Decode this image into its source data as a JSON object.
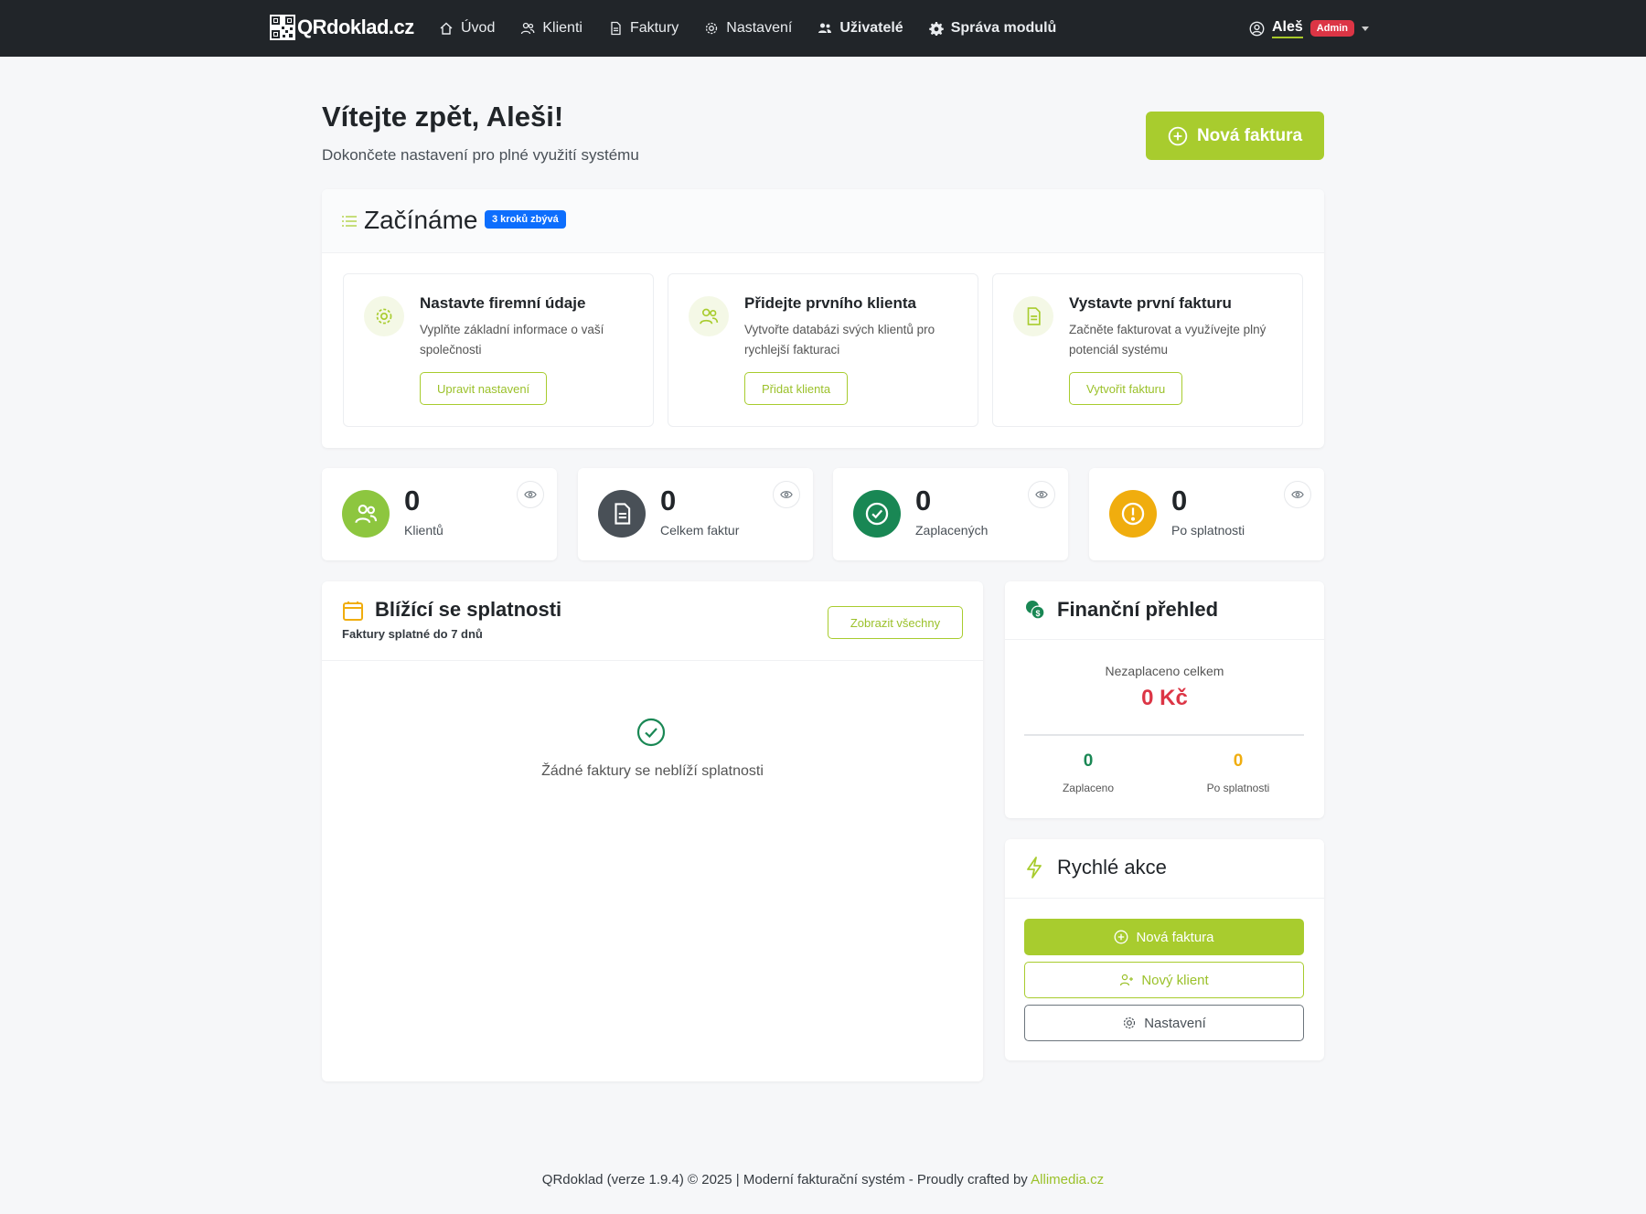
{
  "navbar": {
    "brand": "QRdoklad.cz",
    "links": [
      {
        "label": "Úvod",
        "icon": "home-icon"
      },
      {
        "label": "Klienti",
        "icon": "users-icon"
      },
      {
        "label": "Faktury",
        "icon": "document-icon"
      },
      {
        "label": "Nastavení",
        "icon": "gear-icon"
      },
      {
        "label": "Uživatelé",
        "icon": "people-icon"
      },
      {
        "label": "Správa modulů",
        "icon": "cog-icon"
      }
    ],
    "user": {
      "name": "Aleš",
      "role": "Admin"
    }
  },
  "header": {
    "title": "Vítejte zpět, Aleši!",
    "subtitle": "Dokončete nastavení pro plné využití systému",
    "new_invoice": "Nová faktura"
  },
  "getting_started": {
    "title": "Začínáme",
    "badge": "3 kroků zbývá",
    "steps": [
      {
        "title": "Nastavte firemní údaje",
        "desc": "Vyplňte základní informace o vaší společnosti",
        "button": "Upravit nastavení",
        "icon": "gear-icon"
      },
      {
        "title": "Přidejte prvního klienta",
        "desc": "Vytvořte databázi svých klientů pro rychlejší fakturaci",
        "button": "Přidat klienta",
        "icon": "users-icon"
      },
      {
        "title": "Vystavte první fakturu",
        "desc": "Začněte fakturovat a využívejte plný potenciál systému",
        "button": "Vytvořit fakturu",
        "icon": "document-icon"
      }
    ]
  },
  "stats": [
    {
      "value": "0",
      "label": "Klientů",
      "color": "#8dc63f",
      "icon": "users-icon"
    },
    {
      "value": "0",
      "label": "Celkem faktur",
      "color": "#495057",
      "icon": "document-icon"
    },
    {
      "value": "0",
      "label": "Zaplacených",
      "color": "#198754",
      "icon": "check-circle-icon"
    },
    {
      "value": "0",
      "label": "Po splatnosti",
      "color": "#f0ad0e",
      "icon": "warning-icon"
    }
  ],
  "due": {
    "title": "Blížící se splatnosti",
    "subtitle": "Faktury splatné do 7 dnů",
    "button": "Zobrazit všechny",
    "empty": "Žádné faktury se neblíží splatnosti"
  },
  "finance": {
    "title": "Finanční přehled",
    "unpaid_label": "Nezaplaceno celkem",
    "unpaid_value": "0 Kč",
    "paid_value": "0",
    "paid_label": "Zaplaceno",
    "overdue_value": "0",
    "overdue_label": "Po splatnosti"
  },
  "quick_actions": {
    "title": "Rychlé akce",
    "new_invoice": "Nová faktura",
    "new_client": "Nový klient",
    "settings": "Nastavení"
  },
  "footer": {
    "text": "QRdoklad (verze 1.9.4) © 2025 | Moderní fakturační systém - Proudly crafted by ",
    "link": "Allimedia.cz"
  },
  "colors": {
    "accent": "#a8cc2e",
    "danger": "#dc3545",
    "navbar": "#212529"
  }
}
